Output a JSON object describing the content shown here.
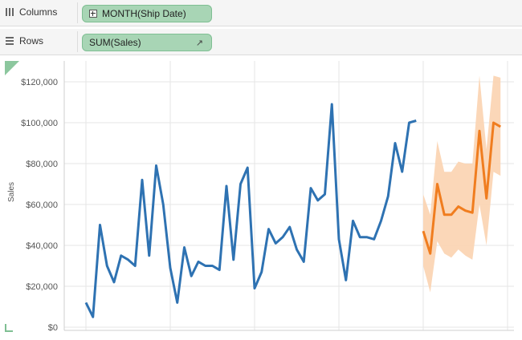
{
  "shelves": {
    "columns": {
      "label": "Columns",
      "pill": "MONTH(Ship Date)"
    },
    "rows": {
      "label": "Rows",
      "pill": "SUM(Sales)"
    }
  },
  "icons": {
    "columns": "columns-shelf-icon",
    "rows": "rows-shelf-icon",
    "pill_columns": "plus-box-icon",
    "pill_rows": "arrow-icon"
  },
  "colors": {
    "pill_bg": "#a8d5b5",
    "actual_line": "#2e72b2",
    "forecast_line": "#f07d1f",
    "forecast_band": "#fbd3b0",
    "grid": "#e6e6e6"
  },
  "chart_data": {
    "type": "line",
    "ylabel": "Sales",
    "ylim": [
      0,
      120000
    ],
    "yticks": [
      "$0",
      "$20,000",
      "$40,000",
      "$60,000",
      "$80,000",
      "$100,000",
      "$120,000"
    ],
    "x_unit": "month",
    "series": [
      {
        "values": [
          12000,
          5000,
          50000,
          30000,
          22000,
          35000,
          33000,
          30000,
          72000,
          35000,
          79000,
          60000,
          29000,
          12000,
          39000,
          25000,
          32000,
          30000,
          30000,
          28000,
          69000,
          33000,
          70000,
          78000,
          19000,
          27000,
          48000,
          41000,
          44000,
          49000,
          38000,
          32000,
          68000,
          62000,
          65000,
          109000,
          43000,
          23000,
          52000,
          44000,
          44000,
          43000,
          52000,
          64000,
          90000,
          76000,
          100000,
          101000
        ]
      },
      {
        "values": [
          47000,
          36000,
          70000,
          55000,
          55000,
          59000,
          57000,
          56000,
          96000,
          63000,
          100000,
          98000
        ],
        "band_low": [
          30000,
          17000,
          42000,
          36000,
          34000,
          38000,
          35000,
          33000,
          60000,
          40000,
          76000,
          74000
        ],
        "band_high": [
          65000,
          55000,
          91000,
          76000,
          76000,
          81000,
          80000,
          80000,
          123000,
          87000,
          123000,
          122000
        ]
      }
    ],
    "grid": true
  }
}
